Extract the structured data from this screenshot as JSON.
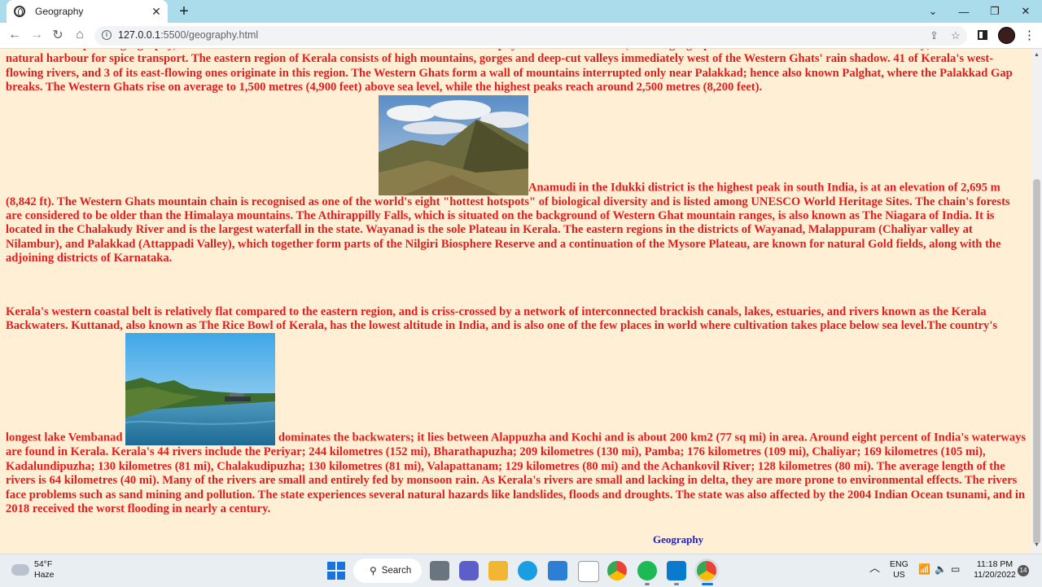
{
  "browser": {
    "tab_title": "Geography",
    "url_host": "127.0.0.1",
    "url_path": ":5500/geography.html",
    "new_tab_glyph": "+",
    "tab_close_glyph": "✕"
  },
  "page": {
    "background": "#ffefd5",
    "text_color": "#e01e1e",
    "para1_top": "Thiruvananthapuram geography, the state of Kerala's coastline forms one of the most distinctive physical features of India, and its geographical location has contributed to its history; it also created a natural harbour for spice transport. The eastern region of Kerala consists of high mountains, gorges and deep-cut valleys immediately west of the Western Ghats' rain shadow. 41 of Kerala's west-flowing rivers, and 3 of its east-flowing ones originate in this region. The Western Ghats form a wall of mountains interrupted only near Palakkad; hence also known Palghat, where the Palakkad Gap breaks. The Western Ghats rise on average to 1,500 metres (4,900 feet) above sea level, while the highest peaks reach around 2,500 metres (8,200 feet).",
    "para1_after_img": "Anamudi in the Idukki district is the highest peak in south India, is at an elevation of 2,695 m (8,842 ft). The Western Ghats mountain chain is recognised as one of the world's eight \"hottest hotspots\" of biological diversity and is listed among UNESCO World Heritage Sites. The chain's forests are considered to be older than the Himalaya mountains. The Athirappilly Falls, which is situated on the background of Western Ghat mountain ranges, is also known as The Niagara of India. It is located in the Chalakudy River and is the largest waterfall in the state. Wayanad is the sole Plateau in Kerala. The eastern regions in the districts of Wayanad, Malappuram (Chaliyar valley at Nilambur), and Palakkad (Attappadi Valley), which together form parts of the Nilgiri Biosphere Reserve and a continuation of the Mysore Plateau, are known for natural Gold fields, along with the adjoining districts of Karnataka.",
    "para2_before_img": "Kerala's western coastal belt is relatively flat compared to the eastern region, and is criss-crossed by a network of interconnected brackish canals, lakes, estuaries, and rivers known as the Kerala Backwaters. Kuttanad, also known as The Rice Bowl of Kerala, has the lowest altitude in India, and is also one of the few places in world where cultivation takes place below sea level.The country's longest lake Vembanad",
    "para2_after_img": "dominates the backwaters; it lies between Alappuzha and Kochi and is about 200 km2 (77 sq mi) in area. Around eight percent of India's waterways are found in Kerala. Kerala's 44 rivers include the Periyar; 244 kilometres (152 mi), Bharathapuzha; 209 kilometres (130 mi), Pamba; 176 kilometres (109 mi), Chaliyar; 169 kilometres (105 mi), Kadalundipuzha; 130 kilometres (81 mi), Chalakudipuzha; 130 kilometres (81 mi), Valapattanam; 129 kilometres (80 mi) and the Achankovil River; 128 kilometres (80 mi). The average length of the rivers is 64 kilometres (40 mi). Many of the rivers are small and entirely fed by monsoon rain. As Kerala's rivers are small and lacking in delta, they are more prone to environmental effects. The rivers face problems such as sand mining and pollution. The state experiences several natural hazards like landslides, floods and droughts. The state was also affected by the 2004 Indian Ocean tsunami, and in 2018 received the worst flooding in nearly a century.",
    "footer_link": "Geography"
  },
  "taskbar": {
    "weather_temp": "54°F",
    "weather_desc": "Haze",
    "search_label": "Search",
    "lang_line1": "ENG",
    "lang_line2": "US",
    "time": "11:18 PM",
    "date": "11/20/2022",
    "notif_count": "14"
  }
}
